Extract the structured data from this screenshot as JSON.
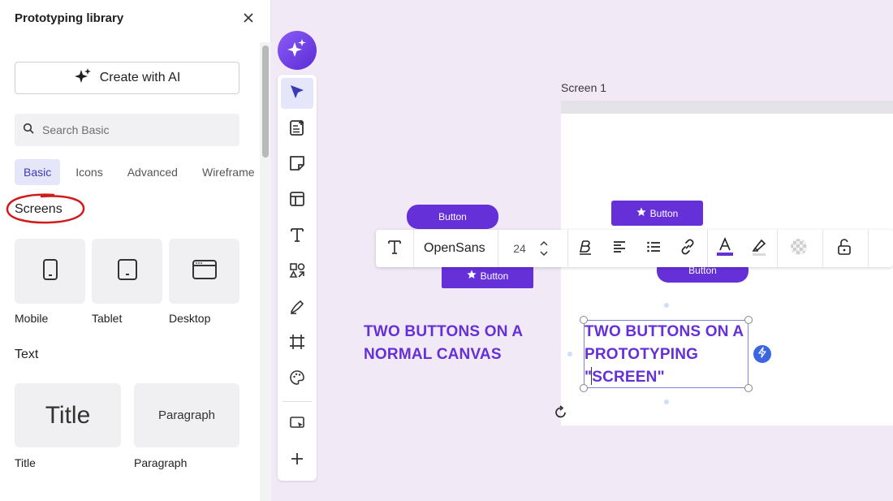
{
  "panel": {
    "title": "Prototyping library",
    "ai_button_label": "Create with AI",
    "search_placeholder": "Search Basic",
    "tabs": [
      {
        "label": "Basic",
        "active": true
      },
      {
        "label": "Icons",
        "active": false
      },
      {
        "label": "Advanced",
        "active": false
      },
      {
        "label": "Wireframe",
        "active": false
      }
    ],
    "sections": {
      "screens": {
        "heading": "Screens",
        "items": [
          {
            "label": "Mobile",
            "icon": "mobile-icon"
          },
          {
            "label": "Tablet",
            "icon": "tablet-icon"
          },
          {
            "label": "Desktop",
            "icon": "desktop-icon"
          }
        ]
      },
      "text": {
        "heading": "Text",
        "items": [
          {
            "label": "Title",
            "preview": "Title"
          },
          {
            "label": "Paragraph",
            "preview": "Paragraph"
          }
        ]
      }
    }
  },
  "canvas": {
    "screen_label": "Screen 1",
    "button_label": "Button",
    "left_caption": "TWO BUTTONS ON A NORMAL CANVAS",
    "left_caption_lines": [
      "TWO BUTTONS ON A",
      "NORMAL CANVAS"
    ],
    "right_caption_lines": [
      "TWO BUTTONS ON A",
      "PROTOTYPING",
      "\"SCREEN\""
    ]
  },
  "toolbar": {
    "font_family": "OpenSans",
    "font_size": "24"
  },
  "colors": {
    "accent": "#6530d8",
    "canvas_bg": "#f1e9f5",
    "annotation_red": "#d11b1b"
  }
}
